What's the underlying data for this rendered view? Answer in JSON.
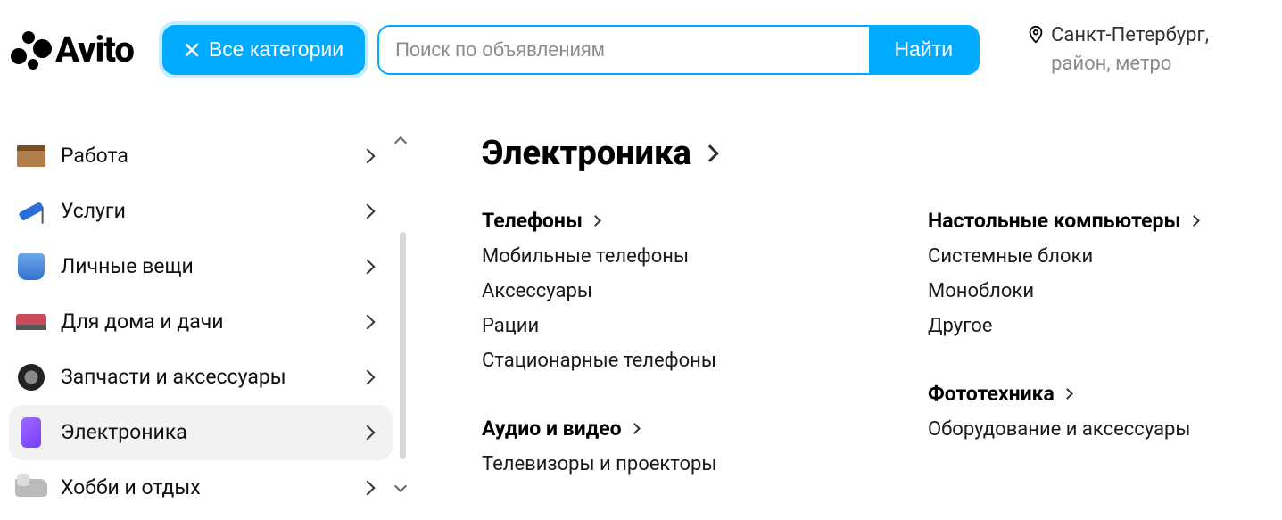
{
  "header": {
    "logo_text": "Avito",
    "all_categories_label": "Все категории",
    "search_placeholder": "Поиск по объявлениям",
    "search_button_label": "Найти",
    "location_city": "Санкт-Петербург,",
    "location_sub": "район, метро"
  },
  "sidebar": {
    "items": [
      {
        "label": "Работа",
        "icon": "box"
      },
      {
        "label": "Услуги",
        "icon": "roller"
      },
      {
        "label": "Личные вещи",
        "icon": "jacket"
      },
      {
        "label": "Для дома и дачи",
        "icon": "sofa"
      },
      {
        "label": "Запчасти и аксессуары",
        "icon": "tire"
      },
      {
        "label": "Электроника",
        "icon": "phone",
        "active": true
      },
      {
        "label": "Хобби и отдых",
        "icon": "shoe"
      }
    ]
  },
  "content": {
    "heading": "Электроника",
    "cols": [
      [
        {
          "title": "Телефоны",
          "items": [
            "Мобильные телефоны",
            "Аксессуары",
            "Рации",
            "Стационарные телефоны"
          ]
        },
        {
          "title": "Аудио и видео",
          "items": [
            "Телевизоры и проекторы"
          ]
        }
      ],
      [
        {
          "title": "Настольные компьютеры",
          "items": [
            "Системные блоки",
            "Моноблоки",
            "Другое"
          ]
        },
        {
          "title": "Фототехника",
          "items": [
            "Оборудование и аксессуары"
          ]
        }
      ]
    ]
  }
}
